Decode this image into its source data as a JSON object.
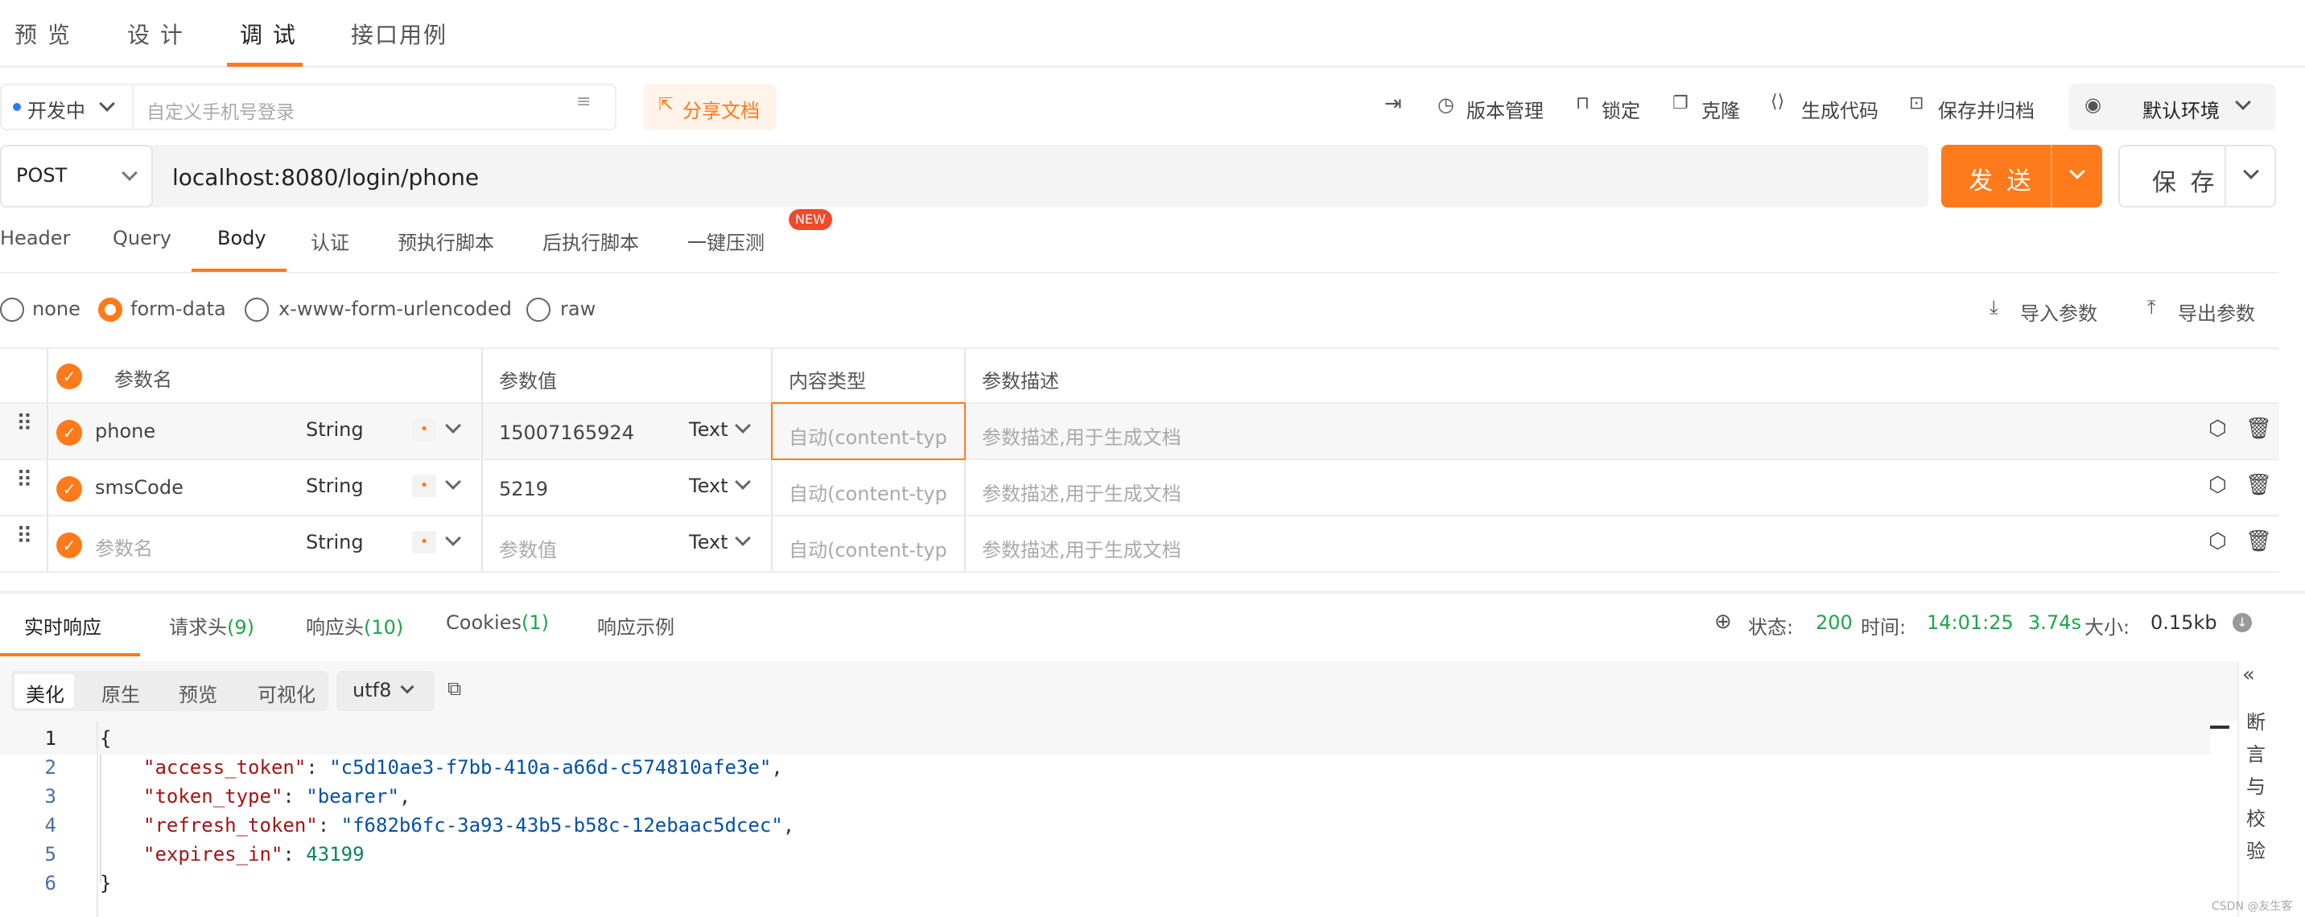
{
  "top_tabs": [
    "预 览",
    "设 计",
    "调 试",
    "接口用例"
  ],
  "env": {
    "status": "开发中",
    "mobile_placeholder": "自定义手机号登录",
    "share": "分享文档"
  },
  "toolbar": {
    "version": "版本管理",
    "lock": "锁定",
    "clone": "克隆",
    "gen_code": "生成代码",
    "save_archive": "保存并归档",
    "env_select": "默认环境"
  },
  "request": {
    "method": "POST",
    "url": "localhost:8080/login/phone",
    "send": "发 送",
    "save": "保 存"
  },
  "req_tabs": [
    "Header",
    "Query",
    "Body",
    "认证",
    "预执行脚本",
    "后执行脚本",
    "一键压测"
  ],
  "new_badge": "NEW",
  "body_types": [
    "none",
    "form-data",
    "x-www-form-urlencoded",
    "raw"
  ],
  "import_params": "导入参数",
  "export_params": "导出参数",
  "table": {
    "headers": [
      "参数名",
      "参数值",
      "内容类型",
      "参数描述"
    ],
    "rows": [
      {
        "name": "phone",
        "type": "String",
        "required": "•",
        "value": "15007165924",
        "vtype": "Text",
        "ctype": "自动(content-typ",
        "desc": "参数描述,用于生成文档"
      },
      {
        "name": "smsCode",
        "type": "String",
        "required": "•",
        "value": "5219",
        "vtype": "Text",
        "ctype": "自动(content-typ",
        "desc": "参数描述,用于生成文档"
      },
      {
        "name": "参数名",
        "type": "String",
        "required": "•",
        "value": "参数值",
        "vtype": "Text",
        "ctype": "自动(content-typ",
        "desc": "参数描述,用于生成文档"
      }
    ]
  },
  "resp_tabs": {
    "live": "实时响应",
    "req_headers": "请求头",
    "req_headers_count": "(9)",
    "resp_headers": "响应头",
    "resp_headers_count": "(10)",
    "cookies": "Cookies",
    "cookies_count": "(1)",
    "examples": "响应示例"
  },
  "status": {
    "label_status": "状态:",
    "code": "200",
    "label_time": "时间:",
    "time": "14:01:25",
    "duration": "3.74s",
    "label_size": "大小:",
    "size": "0.15kb"
  },
  "view_tabs": [
    "美化",
    "原生",
    "预览",
    "可视化"
  ],
  "encoding": "utf8",
  "assert_label": [
    "断",
    "言",
    "与",
    "校",
    "验"
  ],
  "code_lines": [
    "1",
    "2",
    "3",
    "4",
    "5",
    "6"
  ],
  "json_body": {
    "open": "{",
    "k1": "\"access_token\"",
    "v1": "\"c5d10ae3-f7bb-410a-a66d-c574810afe3e\"",
    "k2": "\"token_type\"",
    "v2": "\"bearer\"",
    "k3": "\"refresh_token\"",
    "v3": "\"f682b6fc-3a93-43b5-b58c-12ebaac5dcec\"",
    "k4": "\"expires_in\"",
    "v4": "43199",
    "close": "}"
  },
  "watermark": "CSDN @友生客"
}
